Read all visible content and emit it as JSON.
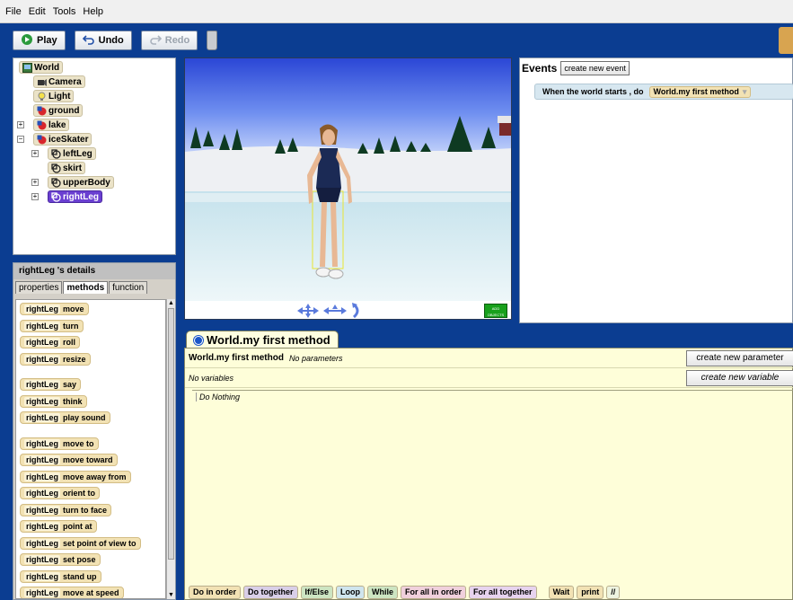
{
  "menu": {
    "items": [
      "File",
      "Edit",
      "Tools",
      "Help"
    ]
  },
  "toolbar": {
    "play": "Play",
    "undo": "Undo",
    "redo": "Redo"
  },
  "tree": {
    "items": [
      {
        "label": "World",
        "icon": "world-icon"
      },
      {
        "label": "Camera",
        "icon": "camera-icon"
      },
      {
        "label": "Light",
        "icon": "light-icon"
      },
      {
        "label": "ground",
        "icon": "object-icon"
      },
      {
        "label": "lake",
        "icon": "object-icon"
      },
      {
        "label": "iceSkater",
        "icon": "object-icon"
      },
      {
        "label": "leftLeg",
        "icon": "part-icon"
      },
      {
        "label": "skirt",
        "icon": "part-icon"
      },
      {
        "label": "upperBody",
        "icon": "part-icon"
      },
      {
        "label": "rightLeg",
        "icon": "part-icon",
        "selected": true
      }
    ]
  },
  "details": {
    "title": "rightLeg 's details",
    "tabs": [
      "properties",
      "methods",
      "function"
    ],
    "active_tab": "methods",
    "object": "rightLeg",
    "methods": [
      "move",
      "turn",
      "roll",
      "resize",
      "say",
      "think",
      "play sound",
      "move to",
      "move   toward",
      "move   away from",
      "orient to",
      "turn to face",
      "point at",
      "set point of view to",
      "set pose",
      "stand up",
      "move at speed"
    ]
  },
  "view": {
    "add_objects": "ADD OBJECTS"
  },
  "events": {
    "title": "Events",
    "create_button": "create new event",
    "rows": [
      {
        "trigger": "When the world starts ,  do",
        "method": "World.my first method"
      }
    ]
  },
  "editor": {
    "tab_title": "World.my first method",
    "method_name": "World.my first method",
    "params": "No parameters",
    "variables": "No variables",
    "create_param": "create new parameter",
    "create_var": "create new variable",
    "body": "Do Nothing",
    "controls": [
      {
        "label": "Do in order",
        "color": "#f2e2b4"
      },
      {
        "label": "Do together",
        "color": "#d9cfe8"
      },
      {
        "label": "If/Else",
        "color": "#cde5c2"
      },
      {
        "label": "Loop",
        "color": "#cfe5ee"
      },
      {
        "label": "While",
        "color": "#cde5c2"
      },
      {
        "label": "For all in order",
        "color": "#f0d0dc"
      },
      {
        "label": "For all together",
        "color": "#e7d3ef"
      },
      {
        "label": "Wait",
        "color": "#f2e2b4"
      },
      {
        "label": "print",
        "color": "#f2e2b4"
      },
      {
        "label": "//",
        "color": "#eef4e0"
      }
    ]
  },
  "colors": {
    "chrome": "#0b3d91",
    "selection": "#6a3fd1",
    "method_tile": "#f2e2b4"
  }
}
